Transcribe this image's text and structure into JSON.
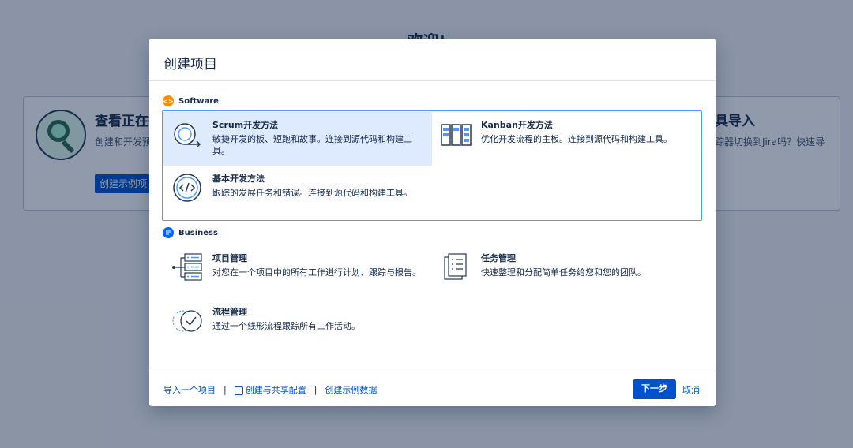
{
  "background": {
    "welcome_title": "欢迎!",
    "left_card": {
      "title": "查看正在行",
      "text": "创建和开发预",
      "button": "创建示例项"
    },
    "right_card": {
      "title": "具导入",
      "text": "踪器切换到Jira吗？快速导"
    }
  },
  "modal": {
    "title": "创建项目",
    "sections": {
      "software": {
        "label": "Software",
        "badge_glyph": "<>",
        "options": [
          {
            "title": "Scrum开发方法",
            "desc": "敏捷开发的板、短跑和故事。连接到源代码和构建工具。"
          },
          {
            "title": "Kanban开发方法",
            "desc": "优化开发流程的主板。连接到源代码和构建工具。"
          },
          {
            "title": "基本开发方法",
            "desc": "跟踪的发展任务和错误。连接到源代码和构建工具。"
          }
        ]
      },
      "business": {
        "label": "Business",
        "options": [
          {
            "title": "项目管理",
            "desc": "对您在一个项目中的所有工作进行计划、跟踪与报告。"
          },
          {
            "title": "任务管理",
            "desc": "快速整理和分配简单任务给您和您的团队。"
          },
          {
            "title": "流程管理",
            "desc": "通过一个线形流程跟踪所有工作活动。"
          }
        ]
      }
    },
    "footer": {
      "import_link": "导入一个项目",
      "separator": "|",
      "shared_config_link": "创建与共享配置",
      "sample_data_link": "创建示例数据",
      "next_button": "下一步",
      "cancel_button": "取消"
    }
  },
  "colors": {
    "accent": "#0052cc",
    "selected_bg": "#deebff",
    "selection_border": "#4c9aff",
    "software_badge": "#ff8b00",
    "business_badge": "#0065ff"
  }
}
